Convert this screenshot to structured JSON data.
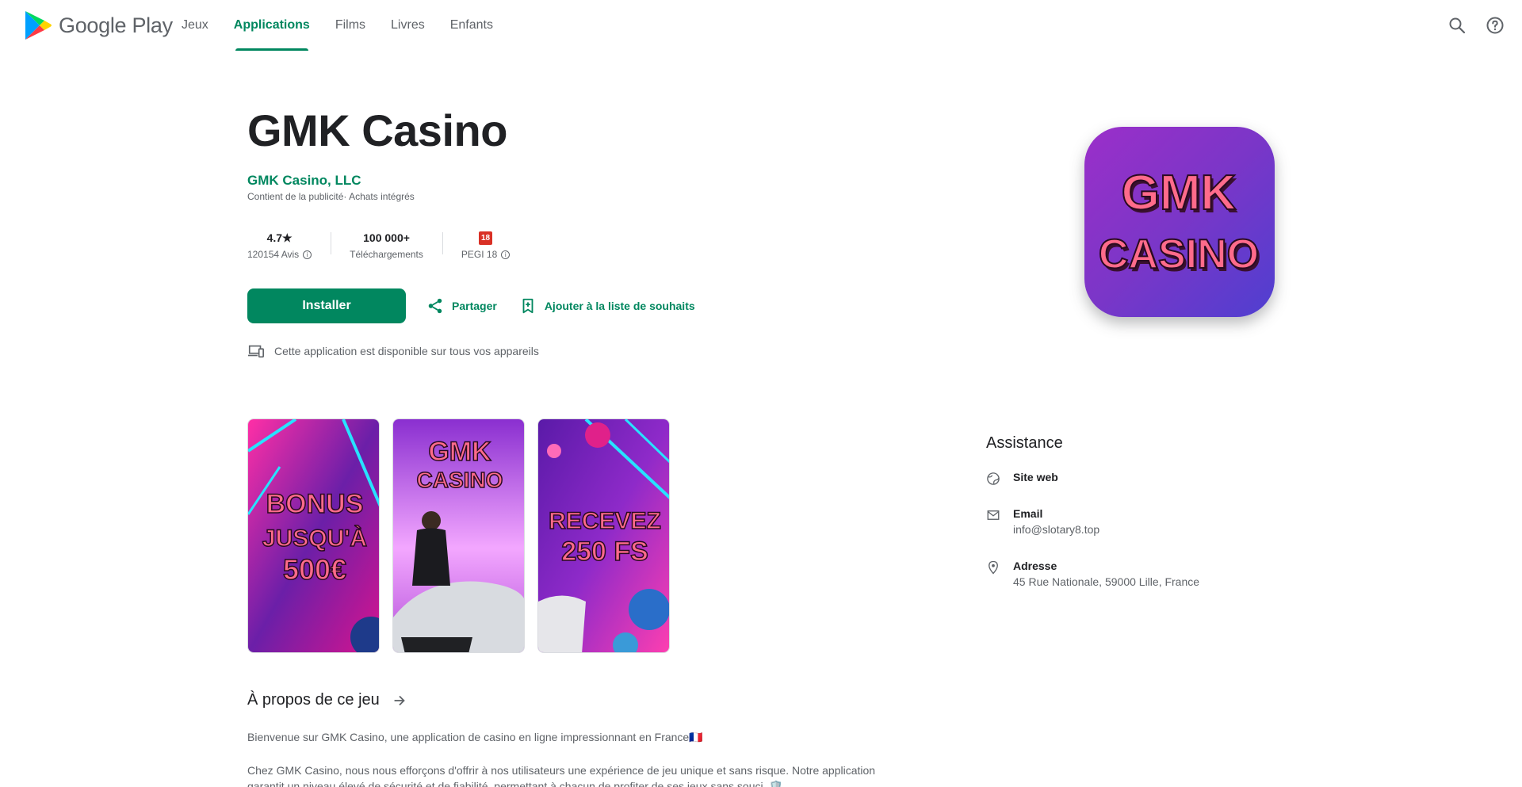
{
  "header": {
    "logo_text": "Google Play",
    "nav": [
      {
        "label": "Jeux",
        "active": false
      },
      {
        "label": "Applications",
        "active": true
      },
      {
        "label": "Films",
        "active": false
      },
      {
        "label": "Livres",
        "active": false
      },
      {
        "label": "Enfants",
        "active": false
      }
    ],
    "icons": [
      "search-icon",
      "help-icon"
    ]
  },
  "app": {
    "title": "GMK Casino",
    "developer": "GMK Casino, LLC",
    "ads_note": "Contient de la publicité· Achats intégrés",
    "stats": {
      "rating": "4.7★",
      "reviews": "120154 Avis",
      "downloads": "100 000+",
      "downloads_label": "Téléchargements",
      "pegi_badge": "18",
      "pegi_label": "PEGI 18"
    },
    "actions": {
      "install": "Installer",
      "share": "Partager",
      "wishlist": "Ajouter à la liste de souhaits"
    },
    "devices_note": "Cette application est disponible sur tous vos appareils",
    "icon": {
      "line1": "GMK",
      "line2": "CASINO"
    }
  },
  "screenshots": [
    {
      "lines": [
        "BONUS",
        "JUSQU'À",
        "500€"
      ]
    },
    {
      "lines": [
        "GMK",
        "CASINO"
      ]
    },
    {
      "lines": [
        "RECEVEZ",
        "250 FS"
      ]
    }
  ],
  "about": {
    "heading": "À propos de ce jeu",
    "p1": "Bienvenue sur GMK Casino, une application de casino en ligne impressionnant en France🇫🇷",
    "p2": "Chez GMK Casino, nous nous efforçons d'offrir à nos utilisateurs une expérience de jeu unique et sans risque. Notre application garantit un niveau élevé de sécurité et de fiabilité, permettant à chacun de profiter de ses jeux sans souci. 🛡️"
  },
  "assistance": {
    "title": "Assistance",
    "website_label": "Site web",
    "email_label": "Email",
    "email_value": "info@slotary8.top",
    "address_label": "Adresse",
    "address_value": "45 Rue Nationale, 59000 Lille, France"
  },
  "colors": {
    "accent": "#01875f",
    "text": "#202124",
    "muted": "#5f6368",
    "icon_pink": "#ff6b8b",
    "icon_purple": "#7b2fbe"
  }
}
